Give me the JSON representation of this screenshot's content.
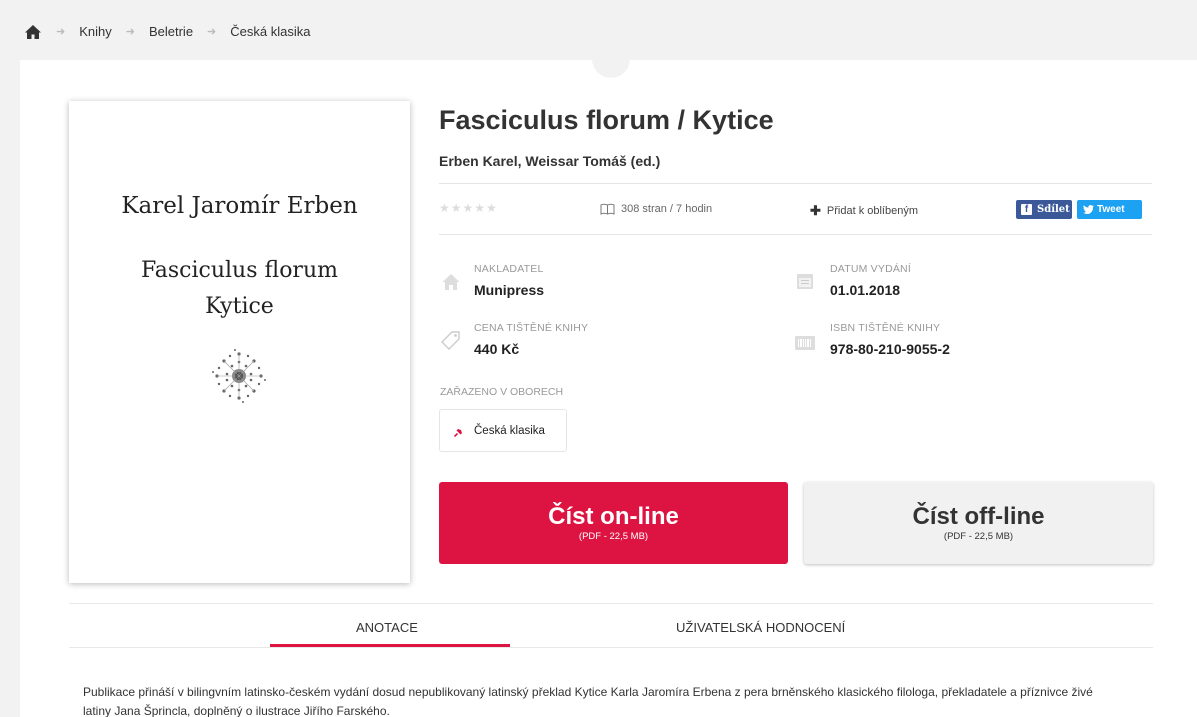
{
  "breadcrumb": {
    "home_icon": "home-icon",
    "items": [
      "Knihy",
      "Beletrie",
      "Česká klasika"
    ]
  },
  "cover": {
    "author": "Karel Jaromír Erben",
    "title_line1": "Fasciculus florum",
    "title_line2": "Kytice",
    "ornament_icon": "flower-ornament"
  },
  "book": {
    "title": "Fasciculus florum / Kytice",
    "authors": "Erben Karel, Weissar Tomáš (ed.)",
    "rating_stars": "★★★★★",
    "rating_value": 0,
    "rating_max": 5,
    "pages": "308 stran / 7 hodin",
    "add_favorite": "Přidat k oblíbeným",
    "share_fb": "Sdílet",
    "share_tw": "Tweet"
  },
  "meta": {
    "publisher_label": "NAKLADATEL",
    "publisher": "Munipress",
    "date_label": "DATUM VYDÁNÍ",
    "date": "01.01.2018",
    "price_label": "CENA TIŠTĚNÉ KNIHY",
    "price": "440 Kč",
    "isbn_label": "ISBN TIŠTĚNÉ KNIHY",
    "isbn": "978-80-210-9055-2"
  },
  "categories": {
    "label": "ZAŘAZENO V OBORECH",
    "items": [
      "Česká klasika"
    ]
  },
  "actions": {
    "online_label": "Číst on-line",
    "online_sub": "(PDF - 22,5 MB)",
    "offline_label": "Číst off-line",
    "offline_sub": "(PDF - 22,5 MB)"
  },
  "tabs": {
    "annotation": "ANOTACE",
    "reviews": "UŽIVATELSKÁ HODNOCENÍ",
    "active": "ANOTACE"
  },
  "annotation": "Publikace přináší v bilingvním latinsko-českém vydání dosud nepublikovaný latinský překlad Kytice Karla Jaromíra Erbena z pera brněnského klasického filologa, překladatele a příznivce živé latiny Jana Šprincla, doplněný o ilustrace Jiřího Farského.",
  "colors": {
    "accent": "#dd1442",
    "facebook": "#3b5998",
    "twitter": "#1da1f2",
    "background": "#f2f2f2"
  }
}
